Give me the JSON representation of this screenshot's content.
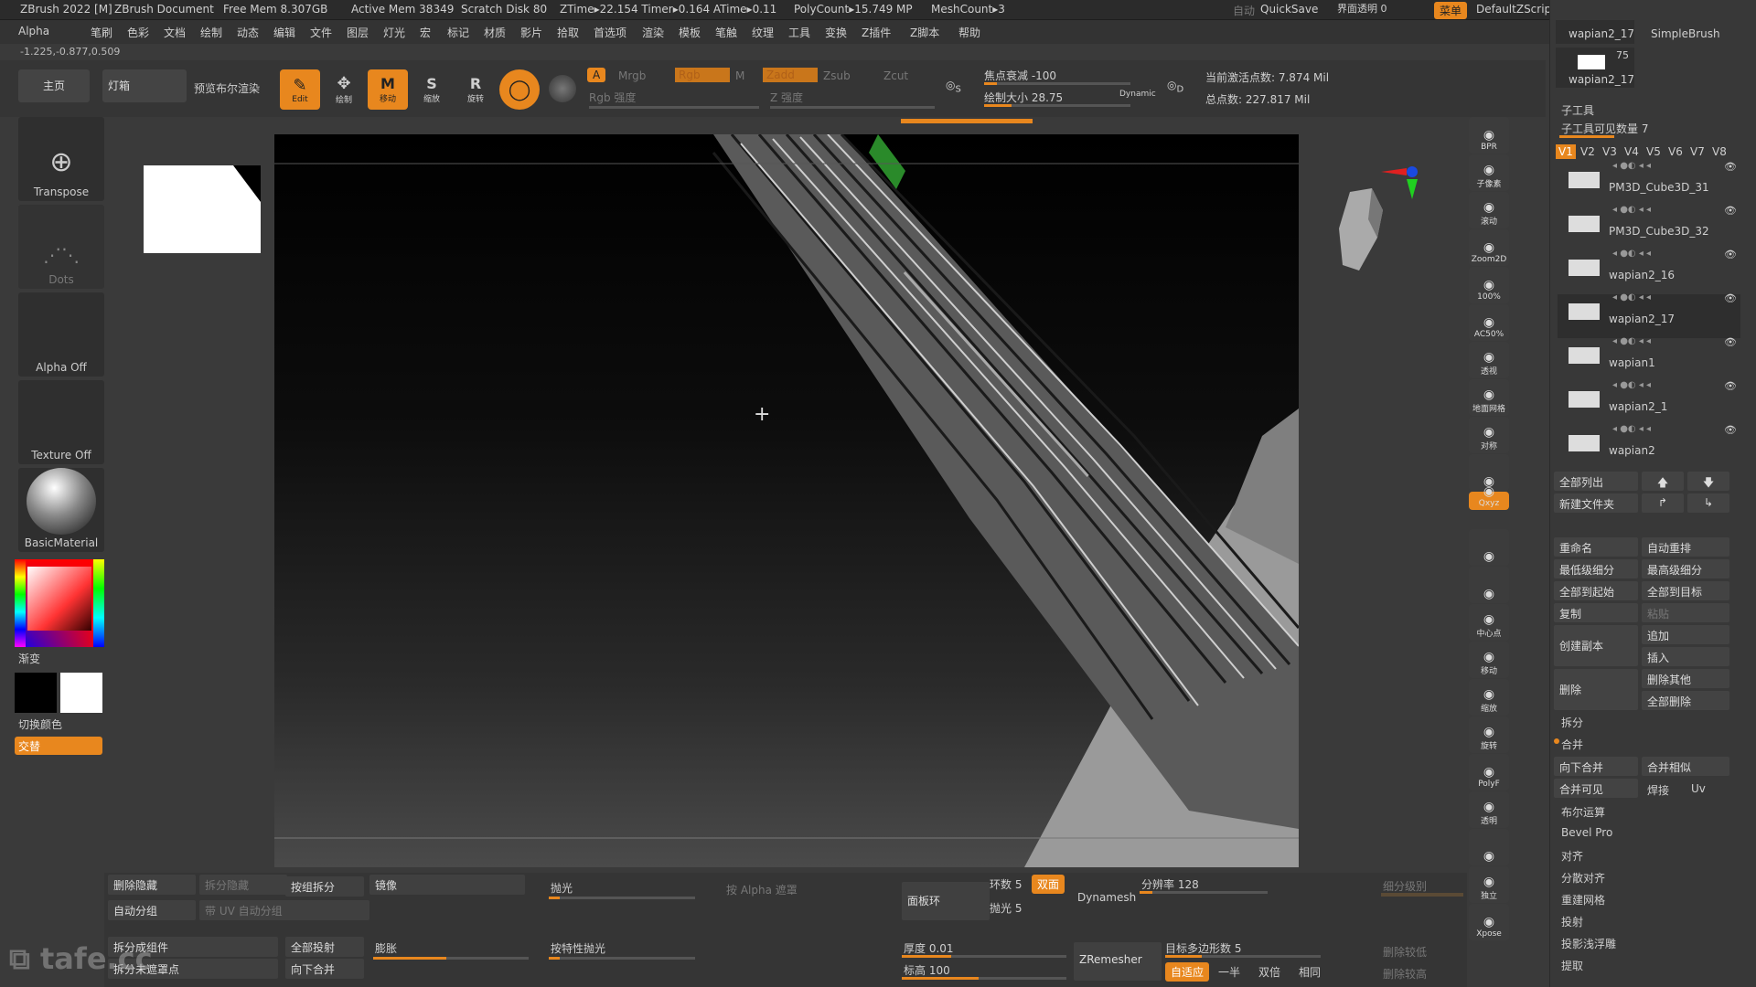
{
  "titlebar": {
    "app": "ZBrush 2022 [M]",
    "doc": "ZBrush Document",
    "free_mem": "Free Mem 8.307GB",
    "active_mem": "Active Mem 38349",
    "scratch": "Scratch Disk 80",
    "ztime": "ZTime▸22.154 Timer▸0.164 ATime▸0.11",
    "polycount": "PolyCount▸15.749 MP",
    "meshcount": "MeshCount▸3",
    "auto": "自动",
    "quicksave": "QuickSave",
    "transparency": "界面透明 0",
    "menu_btn": "菜单",
    "script": "DefaultZScript"
  },
  "menus": [
    "Alpha",
    "笔刷",
    "色彩",
    "文档",
    "绘制",
    "动态",
    "编辑",
    "文件",
    "图层",
    "灯光",
    "宏",
    "标记",
    "材质",
    "影片",
    "拾取",
    "首选项",
    "渲染",
    "模板",
    "笔触",
    "纹理",
    "工具",
    "变换",
    "Z插件",
    "Z脚本",
    "帮助"
  ],
  "coords": "-1.225,-0.877,0.509",
  "shelf": {
    "home": "主页",
    "lightbox": "灯箱",
    "preview": "预览布尔渲染",
    "edit": "Edit",
    "draw": "绘制",
    "move": "移动",
    "scale": "缩放",
    "rotate": "旋转",
    "a_label": "A",
    "mrgb": "Mrgb",
    "rgb": "Rgb",
    "m": "M",
    "zadd": "Zadd",
    "zsub": "Zsub",
    "zcut": "Zcut",
    "rgb_intensity": "Rgb 强度",
    "z_intensity": "Z 强度",
    "focal_label": "焦点衰减 -100",
    "draw_size_label": "绘制大小 28.75",
    "dynamic": "Dynamic",
    "active_points": "当前激活点数: 7.874 Mil",
    "total_points": "总点数: 227.817 Mil",
    "s": "S",
    "d": "D"
  },
  "left": {
    "transpose": "Transpose",
    "dots": "Dots",
    "alpha_off": "Alpha Off",
    "texture_off": "Texture Off",
    "material": "BasicMaterial",
    "gradient": "渐变",
    "switch_color": "切换颜色",
    "alternate": "交替"
  },
  "right_shelf": [
    "BPR",
    "子像素",
    "滚动",
    "Zoom2D",
    "100%",
    "AC50%",
    "透视",
    "地面网格",
    "对称",
    "",
    "Qxyz",
    "",
    "",
    "中心点",
    "移动",
    "缩放",
    "旋转",
    "PolyF",
    "透明",
    "",
    "独立",
    "Xpose"
  ],
  "rpanel": {
    "top_item1": "wapian2_17",
    "top_item2": "SimpleBrush",
    "top_item3_count": "75",
    "top_item3": "wapian2_17",
    "subtool_title": "子工具",
    "visible_count": "子工具可见数量 7",
    "versions": [
      "V1",
      "V2",
      "V3",
      "V4",
      "V5",
      "V6",
      "V7",
      "V8"
    ],
    "subtools": [
      "PM3D_Cube3D_31",
      "PM3D_Cube3D_32",
      "wapian2_16",
      "wapian2_17",
      "wapian1",
      "wapian2_1",
      "wapian2"
    ],
    "list_all": "全部列出",
    "new_folder": "新建文件夹",
    "rename": "重命名",
    "auto_reorder": "自动重排",
    "lowest_sub": "最低级细分",
    "highest_sub": "最高级细分",
    "all_to_start": "全部到起始",
    "all_to_target": "全部到目标",
    "copy": "复制",
    "paste": "粘贴",
    "create_copy": "创建副本",
    "append": "追加",
    "insert": "插入",
    "delete": "删除",
    "delete_other": "删除其他",
    "delete_all": "全部删除",
    "split": "拆分",
    "merge": "合并",
    "merge_down": "向下合并",
    "merge_similar": "合并相似",
    "merge_visible": "合并可见",
    "weld": "焊接",
    "uv": "Uv",
    "boolean": "布尔运算",
    "bevel_pro": "Bevel Pro",
    "align": "对齐",
    "distribute": "分散对齐",
    "remesh": "重建网格",
    "project": "投射",
    "project_relief": "投影浅浮雕",
    "extract": "提取"
  },
  "bottom": {
    "delete_hidden": "删除隐藏",
    "split_hidden": "拆分隐藏",
    "group_split": "按组拆分",
    "mirror": "镜像",
    "polish": "抛光",
    "by_alpha": "按 Alpha 遮罩",
    "auto_groups": "自动分组",
    "uv_groups": "带 UV 自动分组",
    "split_parts": "拆分成组件",
    "project_all": "全部投射",
    "inflate": "膨胀",
    "polish_features": "按特性抛光",
    "split_unmasked": "拆分未遮罩点",
    "merge_down": "向下合并",
    "panel_loops": "面板环",
    "loops": "环数 5",
    "double": "双面",
    "polish_val": "抛光 5",
    "dynamesh": "Dynamesh",
    "resolution": "分辨率 128",
    "thickness": "厚度 0.01",
    "elevation": "标高 100",
    "zremesher": "ZRemesher",
    "target_poly": "目标多边形数 5",
    "adaptive": "自适应",
    "half": "一半",
    "same": "相同",
    "double2": "双倍",
    "sub_level": "细分级别",
    "del_lower": "删除较低",
    "del_higher": "删除较高"
  },
  "watermark": "tafe.cc",
  "colors": {
    "accent": "#e8871e",
    "bg": "#3a3a3a",
    "panel": "#383838"
  }
}
